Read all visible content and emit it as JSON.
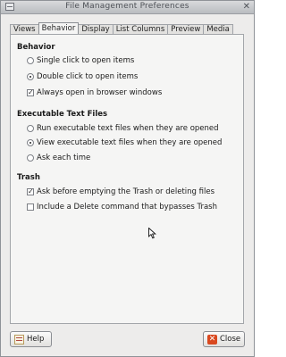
{
  "window": {
    "title": "File Management Preferences"
  },
  "tabs": [
    "Views",
    "Behavior",
    "Display",
    "List Columns",
    "Preview",
    "Media"
  ],
  "active_tab": "Behavior",
  "sections": {
    "behavior": {
      "heading": "Behavior",
      "options": [
        {
          "label": "Single click to open items",
          "type": "radio",
          "checked": false
        },
        {
          "label": "Double click to open items",
          "type": "radio",
          "checked": true
        },
        {
          "label": "Always open in browser windows",
          "type": "checkbox",
          "checked": true
        }
      ]
    },
    "executable": {
      "heading": "Executable Text Files",
      "options": [
        {
          "label": "Run executable text files when they are opened",
          "type": "radio",
          "checked": false
        },
        {
          "label": "View executable text files when they are opened",
          "type": "radio",
          "checked": true
        },
        {
          "label": "Ask each time",
          "type": "radio",
          "checked": false
        }
      ]
    },
    "trash": {
      "heading": "Trash",
      "options": [
        {
          "label": "Ask before emptying the Trash or deleting files",
          "type": "checkbox",
          "checked": true
        },
        {
          "label": "Include a Delete command that bypasses Trash",
          "type": "checkbox",
          "checked": false
        }
      ]
    }
  },
  "buttons": {
    "help": "Help",
    "close": "Close"
  },
  "icons": [
    "window-menu-icon",
    "window-close-icon",
    "help-icon",
    "close-icon",
    "mouse-pointer-icon"
  ]
}
